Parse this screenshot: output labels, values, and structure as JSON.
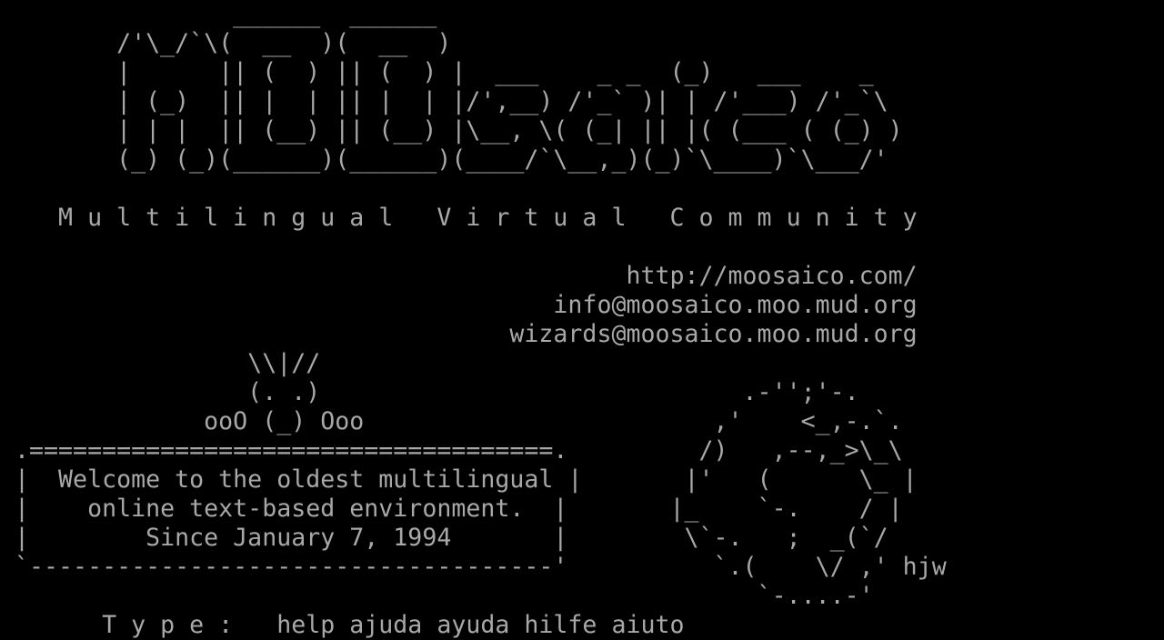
{
  "terminal": {
    "colors": {
      "background": "#000000",
      "foreground": "#a8a8a8"
    },
    "lines": [
      "                ______  ______",
      "        /'\\_/`\\(  __  )(  __  )",
      "        |      || (  ) || (  ) |  ___    _ _  (_)   ___    _",
      "        | (_)  || |  | || |  | |/',__) /'_` )| | /'___) /'_`\\",
      "        | | |  || (__) || (__) |\\__, \\( (_| || |( (___ ( (_) )",
      "        (_) (_)(______)(______)(____/`\\__,_)(_)`\\____)`\\___/'",
      "",
      "    M u l t i l i n g u a l   V i r t u a l   C o m m u n i t y",
      "",
      "                                           http://moosaico.com/",
      "                                      info@moosaico.moo.mud.org",
      "                                   wizards@moosaico.moo.mud.org",
      "                 \\\\|//",
      "                 (. .)                             .-'';'-.",
      "              ooO (_) Ooo                        ,'    <_,-.`.",
      " .====================================.         /)   ,--,_>\\_\\",
      " |  Welcome to the oldest multilingual |       |'   (      \\_ |",
      " |    online text-based environment.  |       |_    `-.    / |",
      " |        Since January 7, 1994       |        \\`-.   ;  _(`/",
      " `------------------------------------'          `.(    \\/ ,' hjw",
      "                                                    `-....-'",
      "       T y p e :   help ajuda ayuda hilfe aiuto"
    ]
  }
}
